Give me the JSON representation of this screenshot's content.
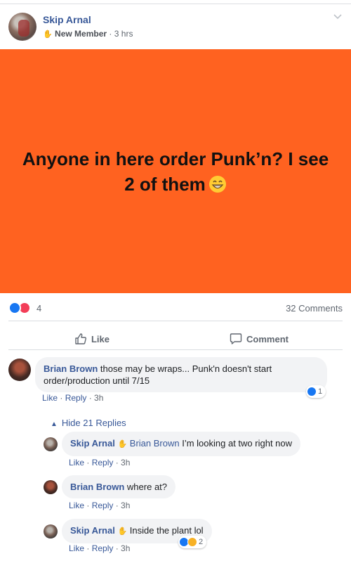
{
  "post": {
    "author": "Skip Arnal",
    "badge": "New Member",
    "separator": "·",
    "time": "3 hrs",
    "banner_text": "Anyone in here order Punk’n? I see 2 of them",
    "reaction_count": "4",
    "comments_count": "32 Comments",
    "like_label": "Like",
    "comment_label": "Comment"
  },
  "comments": [
    {
      "author": "Brian Brown",
      "text": "those may be wraps... Punk'n doesn't start order/production until 7/15",
      "like": "Like",
      "reply": "Reply",
      "time": "3h",
      "reaction_count": "1"
    }
  ],
  "hide_replies": "Hide 21 Replies",
  "replies": [
    {
      "author": "Skip Arnal",
      "mention": "Brian Brown",
      "text": "I’m looking at two right now",
      "like": "Like",
      "reply": "Reply",
      "time": "3h"
    },
    {
      "author": "Brian Brown",
      "text": "where at?",
      "like": "Like",
      "reply": "Reply",
      "time": "3h"
    },
    {
      "author": "Skip Arnal",
      "text": "Inside the plant lol",
      "like": "Like",
      "reply": "Reply",
      "time": "3h",
      "reaction_count": "2"
    }
  ],
  "colors": {
    "banner": "#ff6220",
    "link": "#385898",
    "like_blue": "#1877f2",
    "love_red": "#f33e58"
  }
}
